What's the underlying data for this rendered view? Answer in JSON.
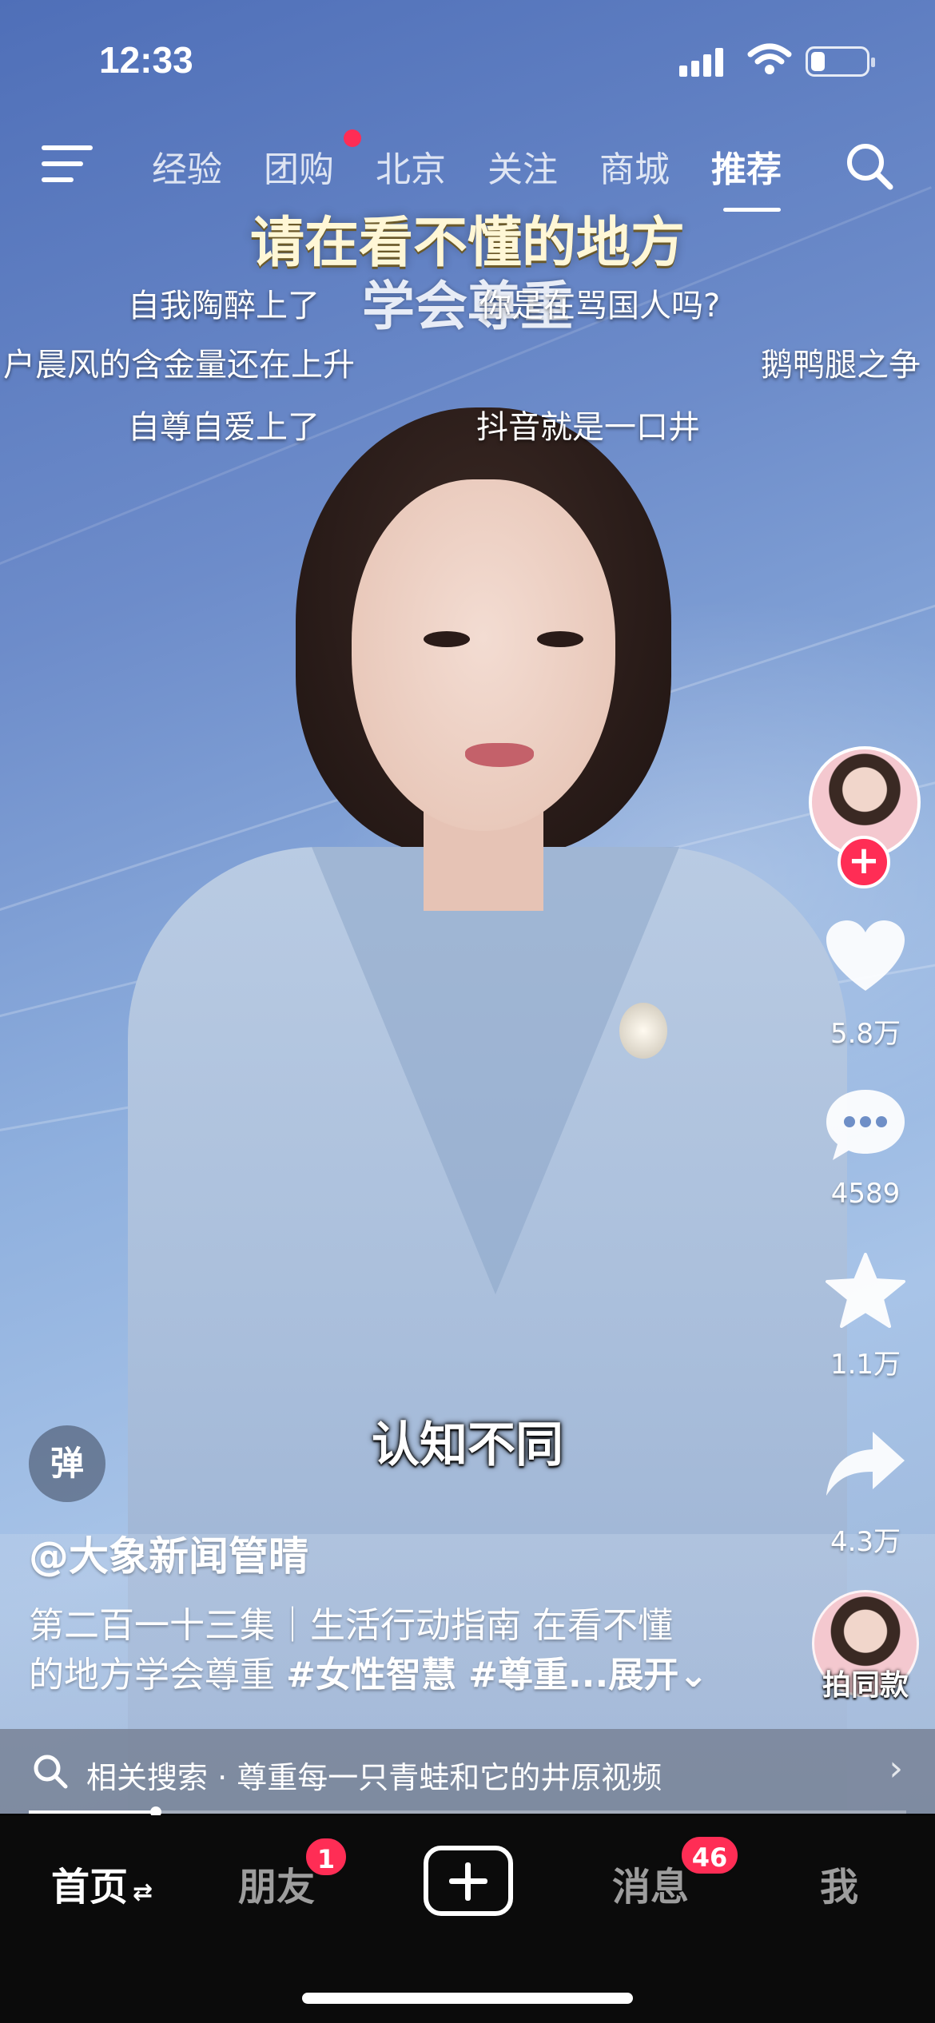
{
  "status_bar": {
    "time": "12:33",
    "battery_level": 0.25
  },
  "top_nav": {
    "tabs": [
      {
        "label": "经验",
        "active": false
      },
      {
        "label": "团购",
        "active": false,
        "dot": true
      },
      {
        "label": "北京",
        "active": false
      },
      {
        "label": "关注",
        "active": false
      },
      {
        "label": "商城",
        "active": false
      },
      {
        "label": "推荐",
        "active": true
      }
    ]
  },
  "overlay": {
    "title_line1": "请在看不懂的地方",
    "title_line2": "学会尊重",
    "danmu": [
      "自我陶醉上了",
      "你是在骂国人吗?",
      "户晨风的含金量还在上升",
      "鹅鸭腿之争",
      "自尊自爱上了",
      "抖音就是一口井"
    ],
    "subtitle": "认知不同"
  },
  "actions": {
    "likes": "5.8万",
    "comments": "4589",
    "favorites": "1.1万",
    "shares": "4.3万",
    "follow_symbol": "+"
  },
  "danmu_toggle": "弹",
  "video_info": {
    "author": "@大象新闻管晴",
    "description_line1": "第二百一十三集｜生活行动指南 在看不懂",
    "description_line2_prefix": "的地方学会尊重 ",
    "tags": "#女性智慧 #尊重...",
    "expand": "展开⌄",
    "same_style_label": "拍同款"
  },
  "related_search": {
    "text": "相关搜索 · 尊重每一只青蛙和它的井原视频",
    "arrow": "›"
  },
  "progress": 0.145,
  "tabbar": {
    "home": "首页",
    "home_suffix": "⇄",
    "friends": "朋友",
    "friends_badge": "1",
    "messages": "消息",
    "messages_badge": "46",
    "me": "我"
  },
  "colors": {
    "accent": "#ff2d55",
    "tabbar_bg": "#0b0b0b"
  }
}
